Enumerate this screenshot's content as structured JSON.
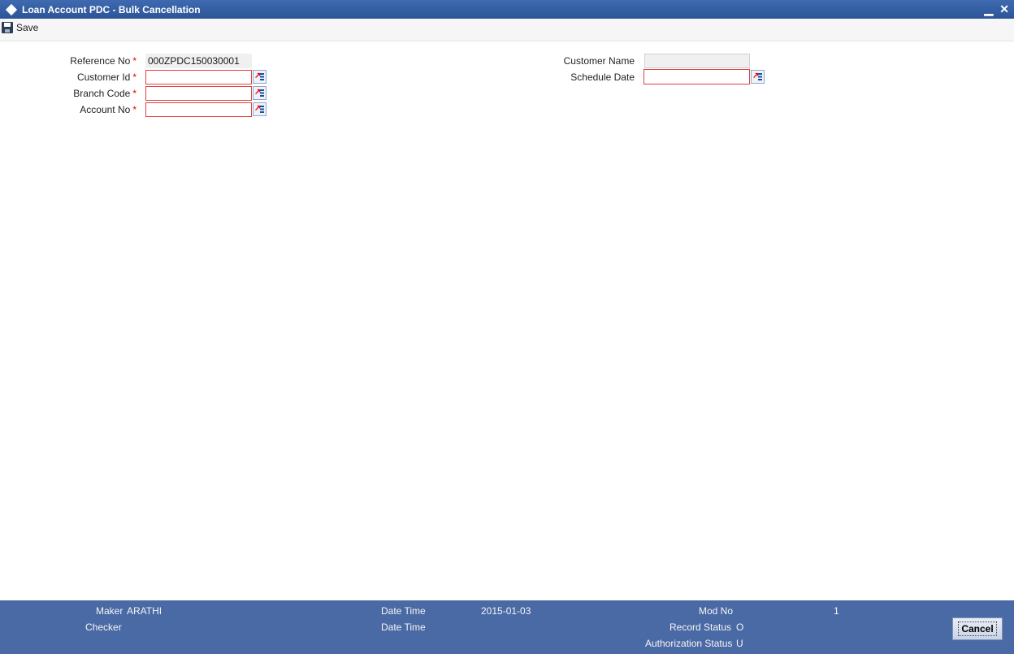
{
  "window": {
    "title": "Loan Account PDC - Bulk Cancellation",
    "minimize_glyph": "▁",
    "close_glyph": "✕"
  },
  "toolbar": {
    "save_label": "Save",
    "save_icon": "save-disk-icon"
  },
  "form": {
    "reference_no": {
      "label": "Reference No",
      "required": "*",
      "value": "000ZPDC150030001"
    },
    "customer_id": {
      "label": "Customer Id",
      "required": "*",
      "value": ""
    },
    "branch_code": {
      "label": "Branch Code",
      "required": "*",
      "value": ""
    },
    "account_no": {
      "label": "Account No",
      "required": "*",
      "value": ""
    },
    "customer_name": {
      "label": "Customer Name",
      "value": ""
    },
    "schedule_date": {
      "label": "Schedule Date",
      "value": ""
    }
  },
  "footer": {
    "maker_label": "Maker",
    "maker_value": "ARATHI",
    "checker_label": "Checker",
    "checker_value": "",
    "date_time_label_1": "Date Time",
    "date_time_value_1": "2015-01-03",
    "date_time_label_2": "Date Time",
    "date_time_value_2": "",
    "mod_no_label": "Mod No",
    "mod_no_value": "1",
    "record_status_label": "Record Status",
    "record_status_value": "O",
    "auth_status_label": "Authorization Status",
    "auth_status_value": "U",
    "cancel_label": "Cancel"
  },
  "colors": {
    "title_bar": "#2c5597",
    "footer": "#4a6aa5",
    "required_border": "#e04040",
    "required_marker": "#e00000"
  }
}
